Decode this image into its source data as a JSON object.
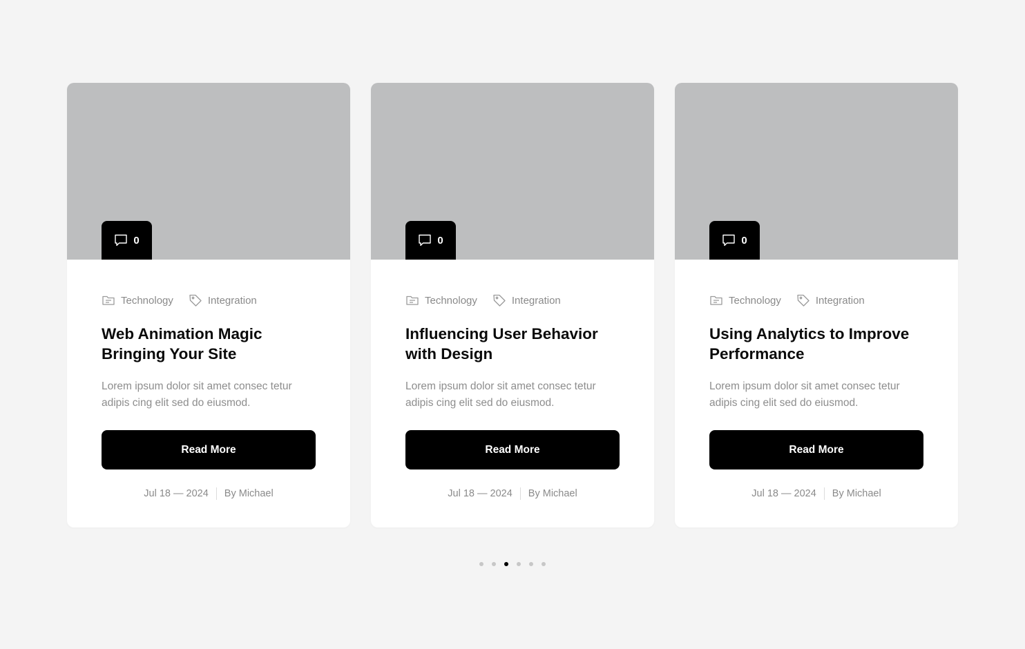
{
  "colors": {
    "background": "#f4f4f4",
    "card": "#ffffff",
    "thumbnail": "#bdbebf",
    "accent": "#000000",
    "muted_text": "#8a8a8a"
  },
  "cards": [
    {
      "comment_count": "0",
      "category": "Technology",
      "tag": "Integration",
      "title": "Web Animation Magic Bringing Your Site",
      "excerpt": "Lorem ipsum dolor sit amet consec tetur adipis cing elit sed do eiusmod.",
      "button_label": "Read More",
      "date": "Jul 18 — 2024",
      "author": "By Michael"
    },
    {
      "comment_count": "0",
      "category": "Technology",
      "tag": "Integration",
      "title": "Influencing User Behavior with Design",
      "excerpt": "Lorem ipsum dolor sit amet consec tetur adipis cing elit sed do eiusmod.",
      "button_label": "Read More",
      "date": "Jul 18 — 2024",
      "author": "By Michael"
    },
    {
      "comment_count": "0",
      "category": "Technology",
      "tag": "Integration",
      "title": "Using Analytics to Improve Performance",
      "excerpt": "Lorem ipsum dolor sit amet consec tetur adipis cing elit sed do eiusmod.",
      "button_label": "Read More",
      "date": "Jul 18 — 2024",
      "author": "By Michael"
    }
  ],
  "pagination": {
    "total": 6,
    "active_index": 2
  },
  "icons": {
    "comment": "comment-icon",
    "category": "folder-icon",
    "tag": "tag-icon"
  }
}
